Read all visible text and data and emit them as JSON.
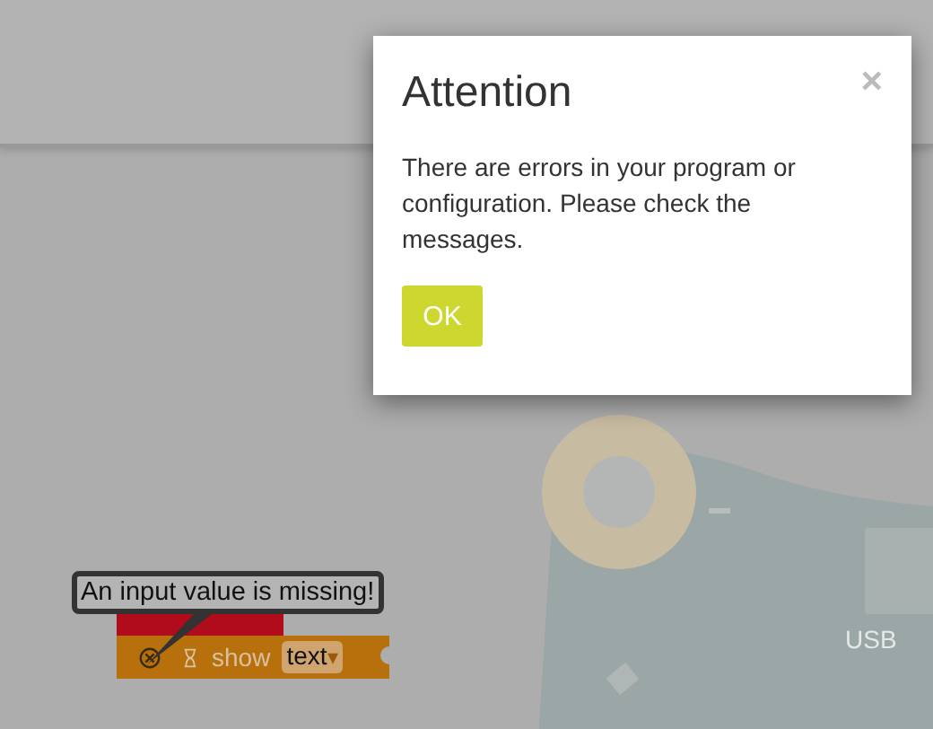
{
  "board": {
    "label": "USB"
  },
  "blocks": [
    {
      "kind": "event"
    },
    {
      "kind": "statement",
      "label": "show",
      "dropdown": "text",
      "dropdown_caret": "▾"
    }
  ],
  "error_tooltip": "An input value is missing!",
  "dialog": {
    "title": "Attention",
    "close": "×",
    "message": "There are errors in your program or configuration. Please check the messages.",
    "button": "OK"
  }
}
